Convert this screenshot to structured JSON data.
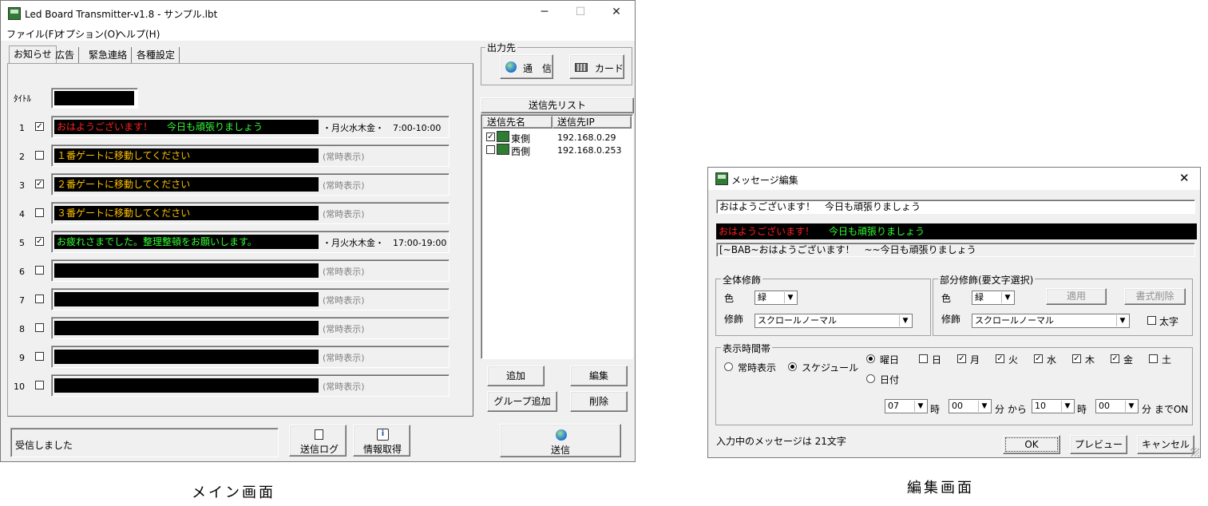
{
  "main": {
    "title": "Led Board Transmitter-v1.8 - サンプル.lbt",
    "window_controls": {
      "minimize": "─",
      "maximize": "☐",
      "close": "✕"
    },
    "menu": [
      "ファイル(F)",
      "オプション(O)",
      "ヘルプ(H)"
    ],
    "tabs": [
      "お知らせ",
      "広告",
      "緊急連絡",
      "各種設定"
    ],
    "title_label": "ﾀｲﾄﾙ",
    "rows": [
      {
        "num": "1",
        "checked": true,
        "segments": [
          {
            "text": "おはようございます！",
            "color": "#ff2020"
          },
          {
            "text": "今日も頑張りましょう",
            "color": "#33ff33"
          }
        ],
        "schedule": "・月火水木金・　7:00-10:00"
      },
      {
        "num": "2",
        "checked": false,
        "segments": [
          {
            "text": "１番ゲートに移動してください",
            "color": "#ffc000"
          }
        ],
        "schedule": "(常時表示)"
      },
      {
        "num": "3",
        "checked": true,
        "segments": [
          {
            "text": "２番ゲートに移動してください",
            "color": "#ffc000"
          }
        ],
        "schedule": "(常時表示)"
      },
      {
        "num": "4",
        "checked": false,
        "segments": [
          {
            "text": "３番ゲートに移動してください",
            "color": "#ffc000"
          }
        ],
        "schedule": "(常時表示)"
      },
      {
        "num": "5",
        "checked": true,
        "segments": [
          {
            "text": "お疲れさまでした。整理整頓をお願いします。",
            "color": "#33ff33"
          }
        ],
        "schedule": "・月火水木金・　17:00-19:00"
      },
      {
        "num": "6",
        "checked": false,
        "segments": [],
        "schedule": "(常時表示)"
      },
      {
        "num": "7",
        "checked": false,
        "segments": [],
        "schedule": "(常時表示)"
      },
      {
        "num": "8",
        "checked": false,
        "segments": [],
        "schedule": "(常時表示)"
      },
      {
        "num": "9",
        "checked": false,
        "segments": [],
        "schedule": "(常時表示)"
      },
      {
        "num": "10",
        "checked": false,
        "segments": [],
        "schedule": "(常時表示)"
      }
    ],
    "output": {
      "group_label": "出力先",
      "comm_button": "通　信",
      "card_button": "カード"
    },
    "dest_list": {
      "header": "送信先リスト",
      "col_name": "送信先名",
      "col_ip": "送信先IP",
      "items": [
        {
          "name": "東側",
          "ip": "192.168.0.29",
          "checked": true
        },
        {
          "name": "西側",
          "ip": "192.168.0.253",
          "checked": false
        }
      ]
    },
    "buttons": {
      "add": "追加",
      "edit": "編集",
      "group_add": "グループ追加",
      "delete": "削除",
      "send_log": "送信ログ",
      "info_get": "情報取得",
      "send": "送信"
    },
    "status": "受信しました",
    "caption": "メイン画面"
  },
  "edit": {
    "title": "メッセージ編集",
    "close": "✕",
    "input_text": "おはようございます！　今日も頑張りましょう",
    "preview_segments": [
      {
        "text": "おはようございます！",
        "color": "#ff2020"
      },
      {
        "text": "今日も頑張りましょう",
        "color": "#33ff33"
      }
    ],
    "code_text": "[~BAB~おはようございます！　~~今日も頑張りましょう",
    "whole": {
      "label": "全体修飾",
      "color_label": "色",
      "color_value": "緑",
      "deco_label": "修飾",
      "deco_value": "スクロールノーマル"
    },
    "partial": {
      "label": "部分修飾(要文字選択)",
      "color_label": "色",
      "color_value": "緑",
      "apply": "適用",
      "clear": "書式削除",
      "deco_label": "修飾",
      "deco_value": "スクロールノーマル",
      "bold": "太字"
    },
    "time": {
      "label": "表示時間帯",
      "always": "常時表示",
      "schedule": "スケジュール",
      "weekday": "曜日",
      "date": "日付",
      "days": [
        {
          "label": "日",
          "checked": false
        },
        {
          "label": "月",
          "checked": true
        },
        {
          "label": "火",
          "checked": true
        },
        {
          "label": "水",
          "checked": true
        },
        {
          "label": "木",
          "checked": true
        },
        {
          "label": "金",
          "checked": true
        },
        {
          "label": "土",
          "checked": false
        }
      ],
      "start_hour": "07",
      "start_min": "00",
      "end_hour": "10",
      "end_min": "00",
      "hour_label": "時",
      "min_from": "分 から",
      "min_to": "分 までON"
    },
    "count_text": "入力中のメッセージは 21文字",
    "ok": "OK",
    "preview": "プレビュー",
    "cancel": "キャンセル",
    "caption": "編集画面"
  }
}
